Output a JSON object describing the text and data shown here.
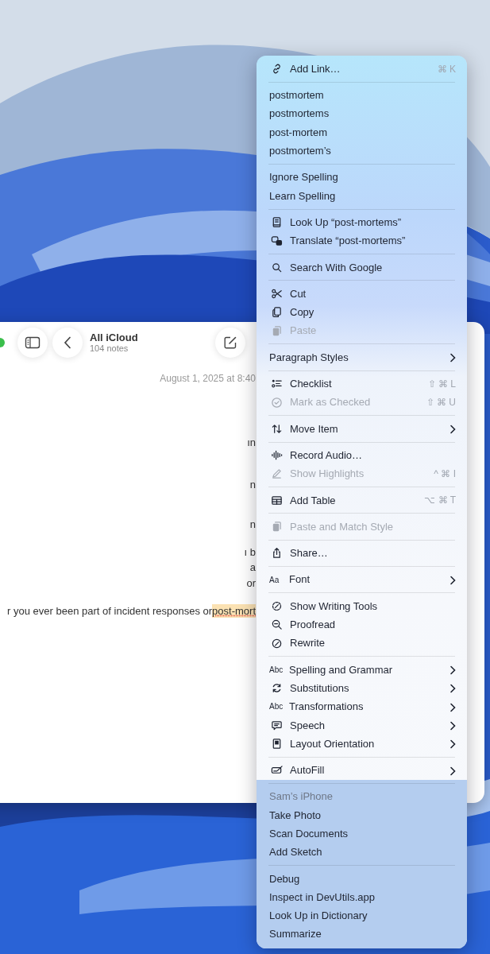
{
  "window": {
    "title": "All iCloud",
    "subtitle": "104 notes",
    "date": "August 1, 2025 at 8:40",
    "fragments": [
      "ın",
      "n",
      "n",
      "ı b",
      "a",
      "or"
    ],
    "line": "r you ever been part of incident responses or ",
    "highlighted": "post-mort"
  },
  "menu": {
    "sections": [
      {
        "tinted": false,
        "items": [
          {
            "kind": "icon",
            "label": "Add Link…",
            "shortcut": "⌘ K",
            "disabled": false,
            "submenu": false
          }
        ]
      },
      {
        "tinted": false,
        "items": [
          {
            "kind": "plain",
            "label": "postmortem",
            "disabled": false,
            "submenu": false
          },
          {
            "kind": "plain",
            "label": "postmortems",
            "disabled": false,
            "submenu": false
          },
          {
            "kind": "plain",
            "label": "post-mortem",
            "disabled": false,
            "submenu": false
          },
          {
            "kind": "plain",
            "label": "postmortem’s",
            "disabled": false,
            "submenu": false
          }
        ]
      },
      {
        "tinted": false,
        "items": [
          {
            "kind": "plain",
            "label": "Ignore Spelling",
            "disabled": false,
            "submenu": false
          },
          {
            "kind": "plain",
            "label": "Learn Spelling",
            "disabled": false,
            "submenu": false
          }
        ]
      },
      {
        "tinted": false,
        "items": [
          {
            "kind": "icon",
            "label": "Look Up “post-mortems”",
            "disabled": false,
            "submenu": false
          },
          {
            "kind": "icon",
            "label": "Translate “post-mortems”",
            "disabled": false,
            "submenu": false
          }
        ]
      },
      {
        "tinted": false,
        "items": [
          {
            "kind": "icon",
            "label": "Search With Google",
            "disabled": false,
            "submenu": false
          }
        ]
      },
      {
        "tinted": false,
        "items": [
          {
            "kind": "icon",
            "label": "Cut",
            "disabled": false,
            "submenu": false
          },
          {
            "kind": "icon",
            "label": "Copy",
            "disabled": false,
            "submenu": false
          },
          {
            "kind": "icon",
            "label": "Paste",
            "disabled": true,
            "submenu": false
          }
        ]
      },
      {
        "tinted": false,
        "items": [
          {
            "kind": "plain",
            "label": "Paragraph Styles",
            "disabled": false,
            "submenu": true
          }
        ]
      },
      {
        "tinted": false,
        "items": [
          {
            "kind": "icon",
            "label": "Checklist",
            "shortcut": "⇧ ⌘ L",
            "disabled": false,
            "submenu": false
          },
          {
            "kind": "icon",
            "label": "Mark as Checked",
            "shortcut": "⇧ ⌘ U",
            "disabled": true,
            "submenu": false
          }
        ]
      },
      {
        "tinted": false,
        "items": [
          {
            "kind": "icon",
            "label": "Move Item",
            "disabled": false,
            "submenu": true
          }
        ]
      },
      {
        "tinted": false,
        "items": [
          {
            "kind": "icon",
            "label": "Record Audio…",
            "disabled": false,
            "submenu": false
          },
          {
            "kind": "icon",
            "label": "Show Highlights",
            "shortcut": "^ ⌘ I",
            "disabled": true,
            "submenu": false
          }
        ]
      },
      {
        "tinted": false,
        "items": [
          {
            "kind": "icon",
            "label": "Add Table",
            "shortcut": "⌥ ⌘ T",
            "disabled": false,
            "submenu": false
          }
        ]
      },
      {
        "tinted": false,
        "items": [
          {
            "kind": "icon",
            "label": "Paste and Match Style",
            "disabled": true,
            "submenu": false
          }
        ]
      },
      {
        "tinted": false,
        "items": [
          {
            "kind": "icon",
            "label": "Share…",
            "disabled": false,
            "submenu": false
          }
        ]
      },
      {
        "tinted": false,
        "items": [
          {
            "kind": "glyph",
            "glyph": "Aa",
            "label": "Font",
            "disabled": false,
            "submenu": true
          }
        ]
      },
      {
        "tinted": false,
        "items": [
          {
            "kind": "icon",
            "label": "Show Writing Tools",
            "disabled": false,
            "submenu": false
          },
          {
            "kind": "icon",
            "label": "Proofread",
            "disabled": false,
            "submenu": false
          },
          {
            "kind": "icon",
            "label": "Rewrite",
            "disabled": false,
            "submenu": false
          }
        ]
      },
      {
        "tinted": false,
        "items": [
          {
            "kind": "glyph",
            "glyph": "Abc",
            "label": "Spelling and Grammar",
            "disabled": false,
            "submenu": true
          },
          {
            "kind": "icon",
            "label": "Substitutions",
            "disabled": false,
            "submenu": true
          },
          {
            "kind": "glyph",
            "glyph": "Abc",
            "label": "Transformations",
            "disabled": false,
            "submenu": true
          },
          {
            "kind": "icon",
            "label": "Speech",
            "disabled": false,
            "submenu": true
          },
          {
            "kind": "icon",
            "label": "Layout Orientation",
            "disabled": false,
            "submenu": true
          }
        ]
      },
      {
        "tinted": false,
        "items": [
          {
            "kind": "icon",
            "label": "AutoFill",
            "disabled": false,
            "submenu": true
          }
        ]
      },
      {
        "tinted": true,
        "items": [
          {
            "kind": "header",
            "label": "Sam’s iPhone",
            "disabled": true,
            "submenu": false
          },
          {
            "kind": "plain",
            "label": "Take Photo",
            "disabled": false,
            "submenu": false
          },
          {
            "kind": "plain",
            "label": "Scan Documents",
            "disabled": false,
            "submenu": false
          },
          {
            "kind": "plain",
            "label": "Add Sketch",
            "disabled": false,
            "submenu": false
          }
        ]
      },
      {
        "tinted": true,
        "items": [
          {
            "kind": "plain",
            "label": "Debug",
            "disabled": false,
            "submenu": false
          },
          {
            "kind": "plain",
            "label": "Inspect in DevUtils.app",
            "disabled": false,
            "submenu": false
          },
          {
            "kind": "plain",
            "label": "Look Up in Dictionary",
            "disabled": false,
            "submenu": false
          },
          {
            "kind": "plain",
            "label": "Summarize",
            "disabled": false,
            "submenu": false
          }
        ]
      }
    ]
  }
}
